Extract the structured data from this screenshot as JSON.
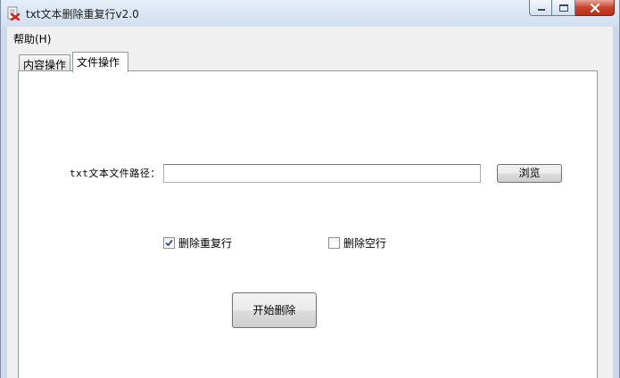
{
  "window": {
    "title": "txt文本删除重复行v2.0",
    "icon": "app-icon",
    "controls": {
      "minimize": "minimize-icon",
      "maximize": "maximize-icon",
      "close": "close-icon"
    }
  },
  "menu": {
    "items": [
      {
        "label": "帮助(H)"
      }
    ]
  },
  "tabs": [
    {
      "label": "内容操作",
      "active": false
    },
    {
      "label": "文件操作",
      "active": true
    }
  ],
  "file_panel": {
    "path_label": "txt文本文件路径：",
    "path_value": "",
    "browse_label": "浏览",
    "options": [
      {
        "label": "删除重复行",
        "checked": true
      },
      {
        "label": "删除空行",
        "checked": false
      }
    ],
    "start_label": "开始删除"
  },
  "colors": {
    "close_button": "#c8432c",
    "titlebar": "#d1dfef",
    "client_bg": "#f0f0f0",
    "panel_bg": "#ffffff",
    "check_mark": "#2a4e8c"
  }
}
